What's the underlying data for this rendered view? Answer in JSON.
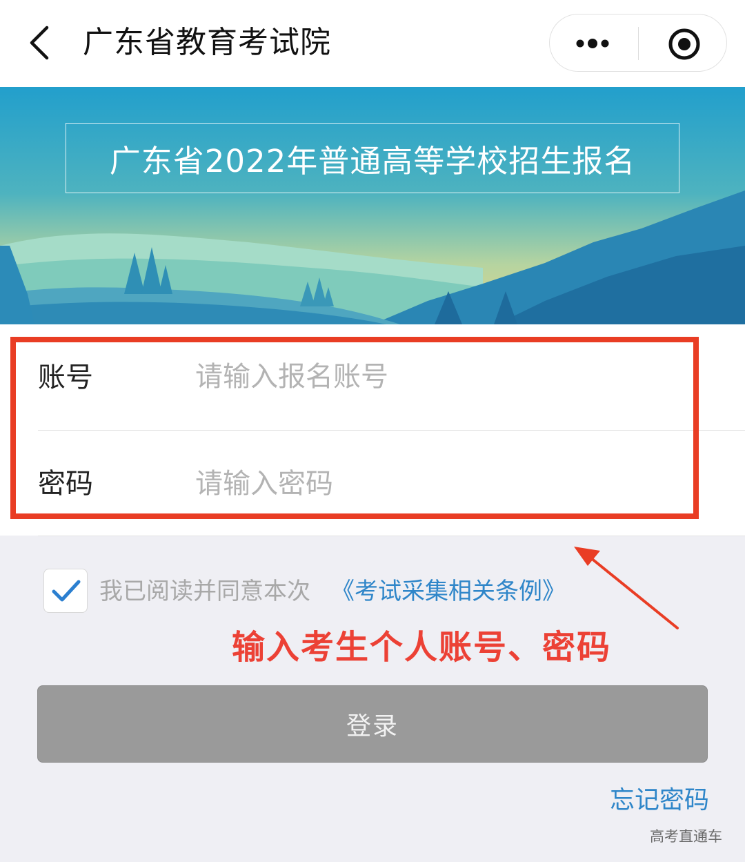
{
  "navbar": {
    "title": "广东省教育考试院",
    "back_icon": "chevron-left-icon",
    "more_icon": "more-dots-icon",
    "close_icon": "target-circle-icon"
  },
  "banner": {
    "title": "广东省2022年普通高等学校招生报名"
  },
  "form": {
    "account": {
      "label": "账号",
      "placeholder": "请输入报名账号",
      "value": ""
    },
    "password": {
      "label": "密码",
      "placeholder": "请输入密码",
      "value": ""
    }
  },
  "agreement": {
    "checked": true,
    "text": "我已阅读并同意本次",
    "link": "《考试采集相关条例》"
  },
  "annotation": {
    "text": "输入考生个人账号、密码",
    "color": "#ec4135"
  },
  "login": {
    "label": "登录"
  },
  "forgot": {
    "label": "忘记密码"
  },
  "watermark": "高考直通车",
  "colors": {
    "link": "#2f86c9",
    "button": "#9a9a9a",
    "highlight": "#e93d24"
  }
}
